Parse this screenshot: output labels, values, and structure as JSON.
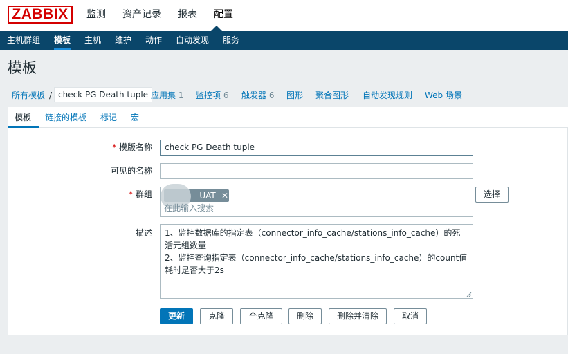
{
  "header": {
    "logo": "ZABBIX",
    "menu": [
      "监测",
      "资产记录",
      "报表",
      "配置"
    ],
    "active_menu": "配置"
  },
  "subnav": {
    "items": [
      "主机群组",
      "模板",
      "主机",
      "维护",
      "动作",
      "自动发现",
      "服务"
    ],
    "active": "模板"
  },
  "page": {
    "title": "模板"
  },
  "objnav": {
    "all_templates": "所有模板",
    "separator": "/",
    "current": "check PG Death tuple",
    "items": [
      {
        "label": "应用集",
        "count": "1"
      },
      {
        "label": "监控项",
        "count": "6"
      },
      {
        "label": "触发器",
        "count": "6"
      },
      {
        "label": "图形",
        "count": ""
      },
      {
        "label": "聚合图形",
        "count": ""
      },
      {
        "label": "自动发现规则",
        "count": ""
      },
      {
        "label": "Web 场景",
        "count": ""
      }
    ]
  },
  "tabs": [
    "模板",
    "链接的模板",
    "标记",
    "宏"
  ],
  "active_tab": "模板",
  "form": {
    "template_name_label": "模版名称",
    "template_name_value": "check PG Death tuple",
    "visible_name_label": "可见的名称",
    "visible_name_value": "",
    "groups_label": "群组",
    "group_chip": "-UAT",
    "groups_placeholder": "在此输入搜索",
    "select_button": "选择",
    "description_label": "描述",
    "description_value": "1、监控数据库的指定表（connector_info_cache/stations_info_cache）的死活元组数量\n2、监控查询指定表（connector_info_cache/stations_info_cache）的count值耗时是否大于2s",
    "required_mark": "*"
  },
  "buttons": {
    "update": "更新",
    "clone": "克隆",
    "full_clone": "全克隆",
    "delete": "删除",
    "delete_and_clear": "删除并清除",
    "cancel": "取消"
  },
  "colors": {
    "brand": "#d40000",
    "nav_bg": "#0a466a",
    "link": "#0275b8",
    "primary_button": "#0275b8"
  }
}
